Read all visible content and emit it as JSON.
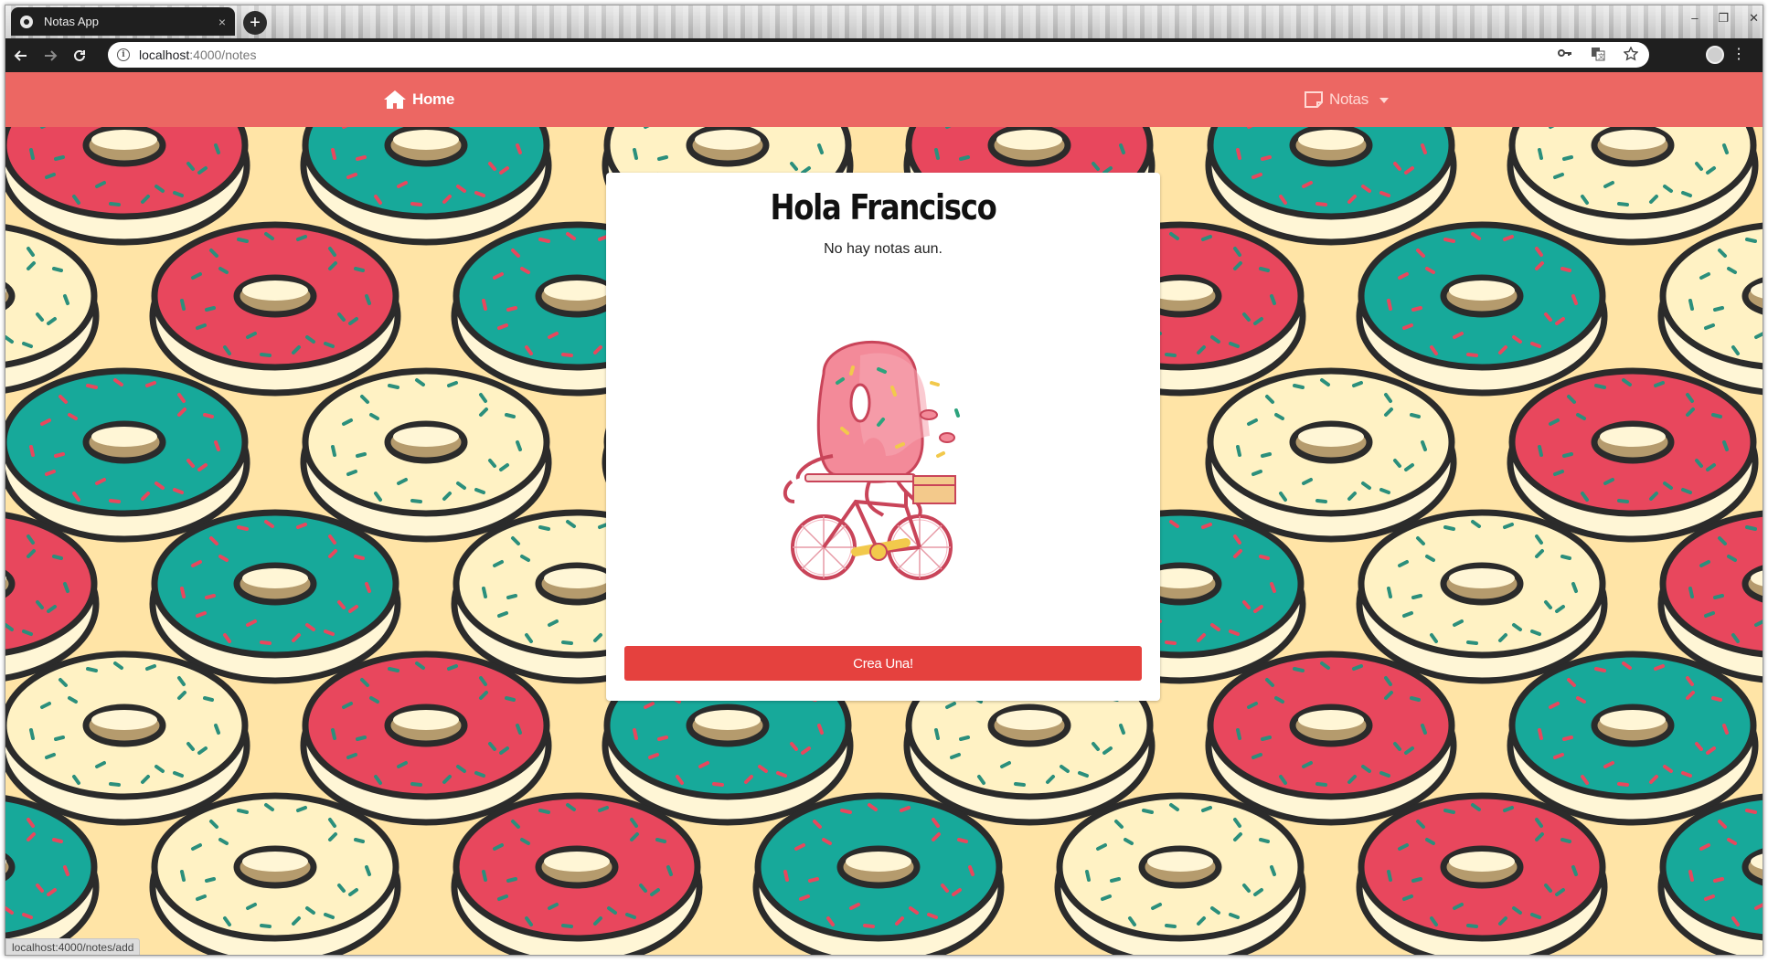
{
  "browser": {
    "tab_title": "Notas App",
    "tab_close": "×",
    "new_tab": "+",
    "url_host": "localhost",
    "url_rest": ":4000/notes",
    "controls": {
      "minimize": "–",
      "restore": "❐",
      "close": "✕"
    },
    "status_url": "localhost:4000/notes/add"
  },
  "navbar": {
    "home_label": "Home",
    "notes_label": "Notas",
    "background": "#ec6763"
  },
  "card": {
    "title": "Hola Francisco",
    "subtitle": "No hay notas aun.",
    "button_label": "Crea Una!",
    "button_color": "#e5413e"
  },
  "background": {
    "color": "#ffe4a6",
    "donut_colors": [
      "#e8475d",
      "#17a99a",
      "#fff2c4"
    ]
  }
}
